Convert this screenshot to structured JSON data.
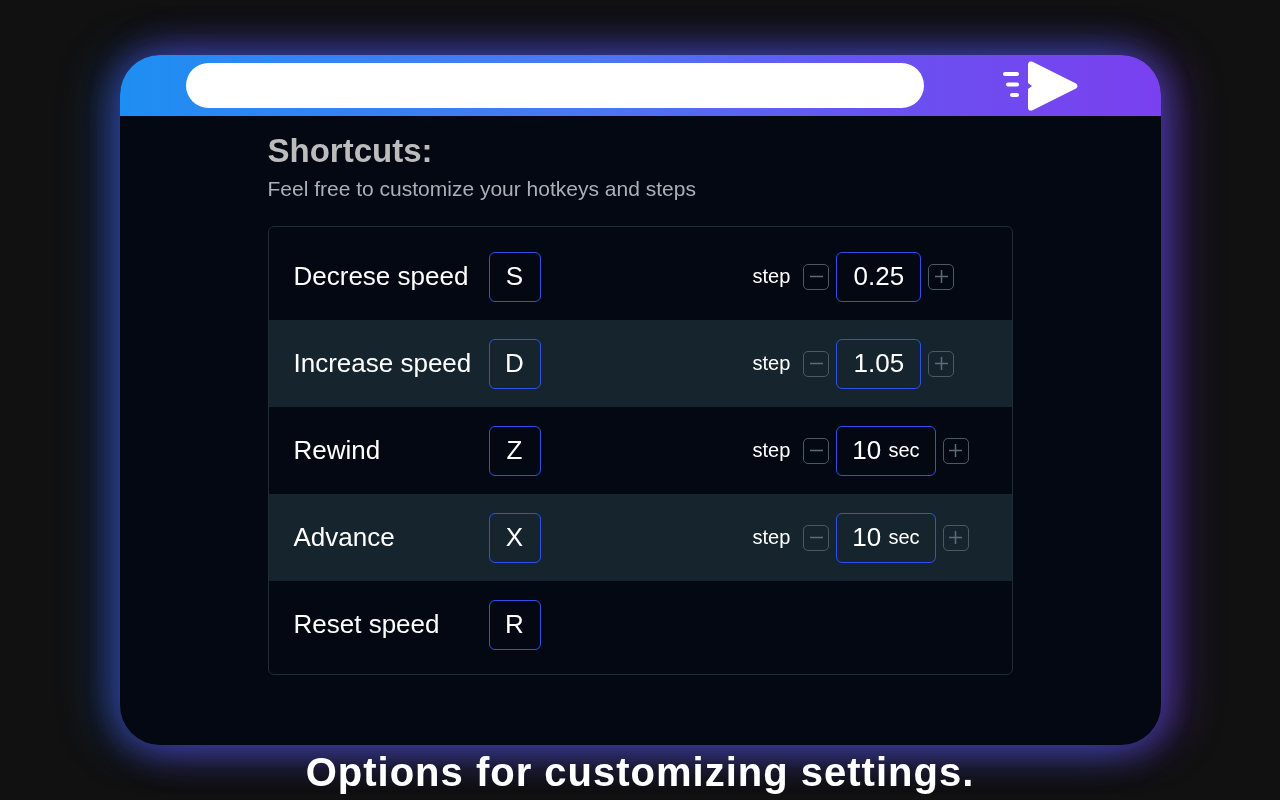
{
  "heading": "Shortcuts:",
  "subtitle": "Feel free to customize your hotkeys and steps",
  "shortcuts": [
    {
      "label": "Decrese speed",
      "key": "S",
      "step": {
        "label": "step",
        "value": "0.25"
      }
    },
    {
      "label": "Increase speed",
      "key": "D",
      "step": {
        "label": "step",
        "value": "1.05"
      }
    },
    {
      "label": "Rewind",
      "key": "Z",
      "step": {
        "label": "step",
        "value": "10",
        "unit": "sec"
      }
    },
    {
      "label": "Advance",
      "key": "X",
      "step": {
        "label": "step",
        "value": "10",
        "unit": "sec"
      }
    },
    {
      "label": "Reset speed",
      "key": "R"
    }
  ],
  "caption": "Options for customizing settings."
}
